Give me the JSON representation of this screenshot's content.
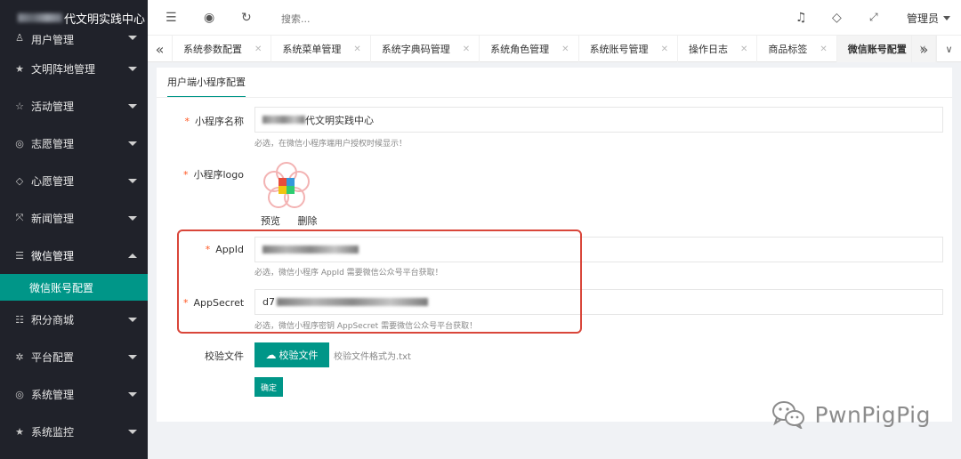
{
  "sidebar": {
    "brand_suffix": "代文明实践中心",
    "items": [
      {
        "label": "用户管理",
        "icon": "user-icon"
      },
      {
        "label": "文明阵地管理",
        "icon": "star-icon"
      },
      {
        "label": "活动管理",
        "icon": "star-outline-icon"
      },
      {
        "label": "志愿管理",
        "icon": "shield-icon"
      },
      {
        "label": "心愿管理",
        "icon": "tag-icon"
      },
      {
        "label": "新闻管理",
        "icon": "expand-icon"
      },
      {
        "label": "微信管理",
        "icon": "list-icon"
      },
      {
        "label": "积分商城",
        "icon": "sliders-icon"
      },
      {
        "label": "平台配置",
        "icon": "gear-icon"
      },
      {
        "label": "系统管理",
        "icon": "shield-icon"
      },
      {
        "label": "系统监控",
        "icon": "star-icon"
      }
    ],
    "active_sub": "微信账号配置"
  },
  "topbar": {
    "search_placeholder": "搜索...",
    "admin_label": "管理员"
  },
  "tabs": [
    {
      "label": "系统参数配置"
    },
    {
      "label": "系统菜单管理"
    },
    {
      "label": "系统字典码管理"
    },
    {
      "label": "系统角色管理"
    },
    {
      "label": "系统账号管理"
    },
    {
      "label": "操作日志"
    },
    {
      "label": "商品标签"
    },
    {
      "label": "微信账号配置"
    }
  ],
  "form": {
    "panel_tab": "用户端小程序配置",
    "name_label": "小程序名称",
    "name_value_suffix": "代文明实践中心",
    "name_hint": "必选，在微信小程序端用户授权时候显示！",
    "logo_label": "小程序logo",
    "logo_preview": "预览",
    "logo_delete": "删除",
    "appid_label": "AppId",
    "appid_hint": "必选，微信小程序 AppId 需要微信公众号平台获取！",
    "secret_label": "AppSecret",
    "secret_prefix": "d7",
    "secret_hint": "必选，微信小程序密钥 AppSecret 需要微信公众号平台获取！",
    "verify_label": "校验文件",
    "verify_button": "校验文件",
    "verify_hint": "校验文件格式为.txt",
    "ok_button": "确定",
    "required_mark": "*"
  },
  "watermark": "PwnPigPig",
  "colors": {
    "accent": "#009688",
    "sidebar_bg": "#20222a",
    "highlight": "#d9463a",
    "required": "#ff5722"
  }
}
